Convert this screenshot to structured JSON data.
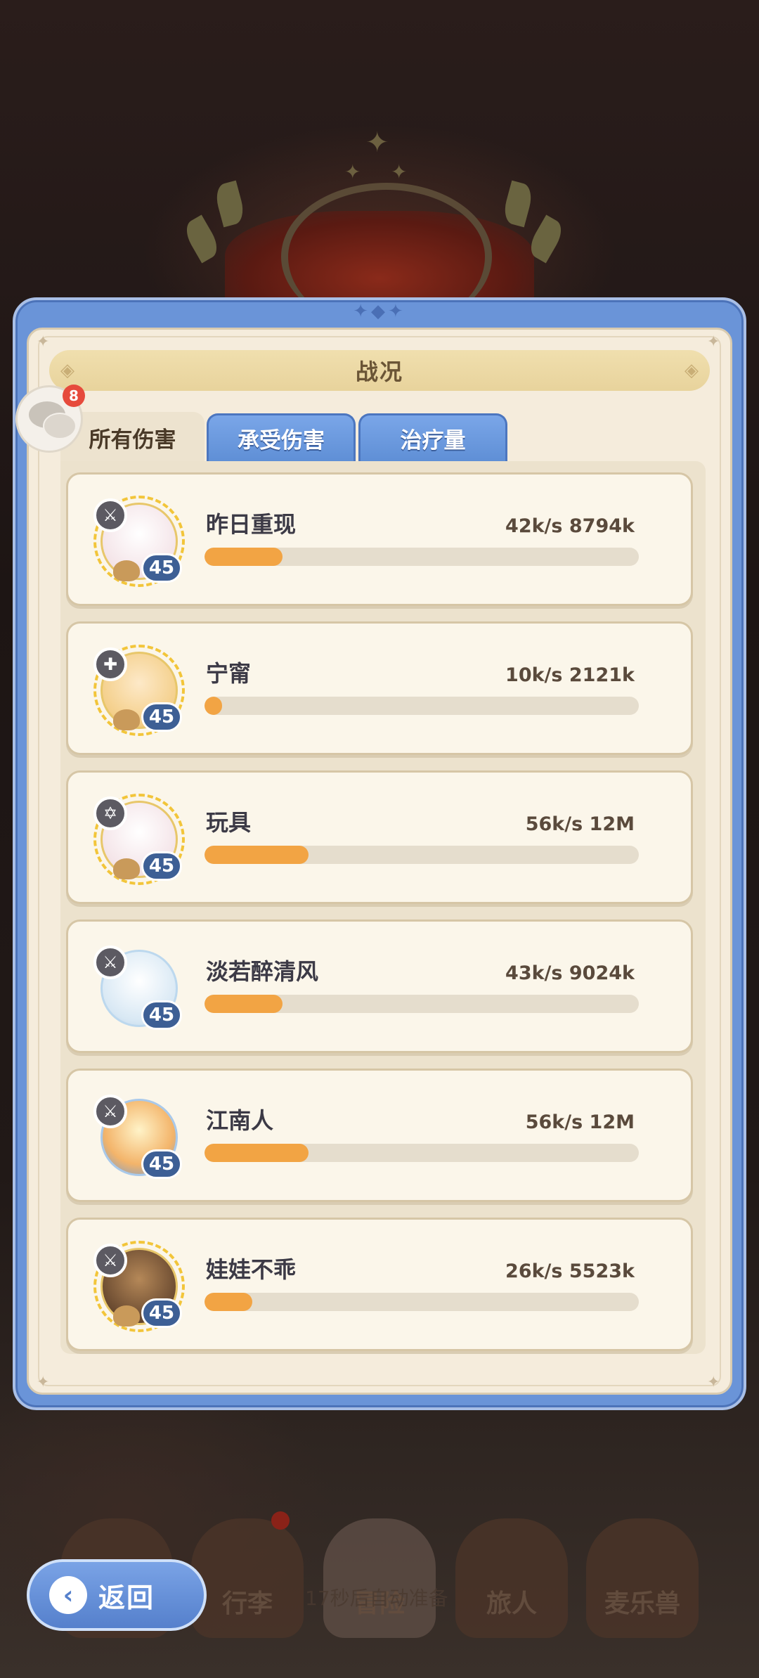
{
  "panel": {
    "title": "战况",
    "tabs": [
      {
        "label": "所有伤害",
        "active": true
      },
      {
        "label": "承受伤害",
        "active": false
      },
      {
        "label": "治疗量",
        "active": false
      }
    ]
  },
  "chat": {
    "badge_count": "8",
    "icon": "chat-bubbles-icon"
  },
  "players": [
    {
      "name": "昨日重现",
      "level": "45",
      "stats": "42k/s 8794k",
      "progress_pct": 18,
      "class_icon": "sword-icon"
    },
    {
      "name": "宁甯",
      "level": "45",
      "stats": "10k/s 2121k",
      "progress_pct": 4,
      "class_icon": "cross-icon"
    },
    {
      "name": "玩具",
      "level": "45",
      "stats": "56k/s 12M",
      "progress_pct": 24,
      "class_icon": "star-icon"
    },
    {
      "name": "淡若醉清风",
      "level": "45",
      "stats": "43k/s 9024k",
      "progress_pct": 18,
      "class_icon": "sword-icon"
    },
    {
      "name": "江南人",
      "level": "45",
      "stats": "56k/s 12M",
      "progress_pct": 24,
      "class_icon": "sword-icon"
    },
    {
      "name": "娃娃不乖",
      "level": "45",
      "stats": "26k/s 5523k",
      "progress_pct": 11,
      "class_icon": "sword-icon"
    }
  ],
  "bottom_nav": [
    {
      "label": ""
    },
    {
      "label": "行李"
    },
    {
      "label": "冒险"
    },
    {
      "label": "旅人"
    },
    {
      "label": "麦乐兽"
    }
  ],
  "ghost_text": "17秒后自动准备",
  "back_button": {
    "label": "返回"
  },
  "colors": {
    "accent_blue": "#6a94d8",
    "progress": "#f2a444",
    "badge": "#e64a3c"
  }
}
